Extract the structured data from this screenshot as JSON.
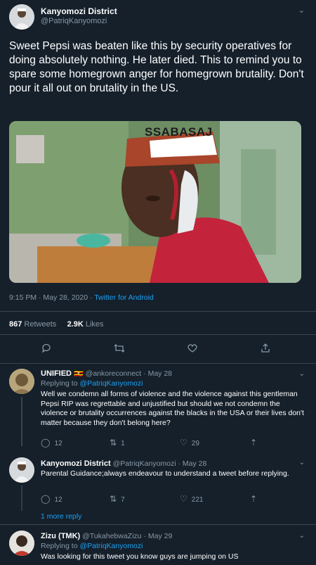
{
  "main_tweet": {
    "name": "Kanyomozi District",
    "handle": "@PatriqKanyomozi",
    "text": "Sweet Pepsi was beaten like this by security operatives for doing absolutely nothing. He later died. This to remind you to spare some homegrown anger for homegrown brutality. Don't pour it all out on brutality in the US.",
    "media_caption": "SSABASAJ",
    "timestamp": "9:15 PM · May 28, 2020 · ",
    "source": "Twitter for Android",
    "retweets_count": "867",
    "retweets_label": "Retweets",
    "likes_count": "2.9K",
    "likes_label": "Likes"
  },
  "replies": [
    {
      "name": "UNIFIED 🇺🇬",
      "handle": "@ankoreconnect",
      "date": "· May 28",
      "replying_prefix": "Replying to ",
      "replying_to": "@PatriqKanyomozi",
      "text": "Well we condemn all forms of violence and the violence against this gentleman Pepsi RIP was regrettable and unjustified but should we not condemn the violence or brutality occurrences against the blacks in the USA or their lives don't matter because they don't belong here?",
      "reply_count": "12",
      "retweet_count": "1",
      "like_count": "29"
    },
    {
      "name": "Kanyomozi District",
      "handle": "@PatriqKanyomozi",
      "date": "· May 28",
      "text": "Parental Guidance;always endeavour to understand a tweet before replying.",
      "reply_count": "12",
      "retweet_count": "7",
      "like_count": "221"
    },
    {
      "name": "Zizu (TMK)",
      "handle": "@TukahebwaZizu",
      "date": "· May 29",
      "replying_prefix": "Replying to ",
      "replying_to": "@PatriqKanyomozi",
      "text": "Was looking for this tweet you know guys are jumping on US"
    }
  ],
  "more_replies": "1 more reply",
  "colors": {
    "background": "#15202b",
    "muted": "#8899a6",
    "accent": "#1da1f2",
    "divider": "#38444d"
  }
}
